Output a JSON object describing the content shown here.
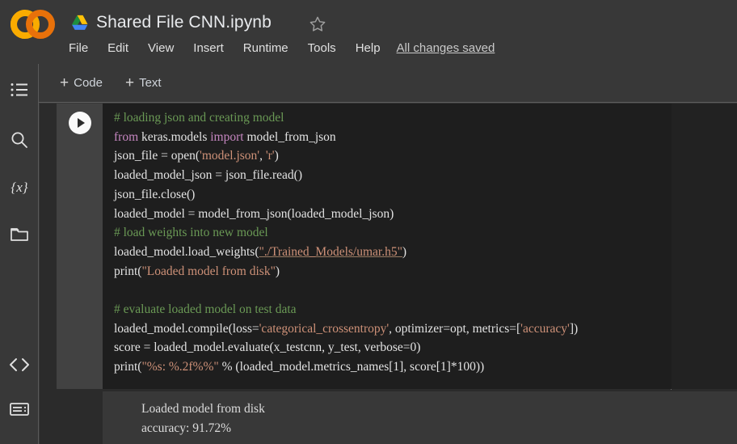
{
  "header": {
    "logo_name": "colab-logo",
    "drive_icon": "google-drive-icon",
    "doc_title": "Shared File CNN.ipynb",
    "star_icon": "star-outline-icon",
    "menu": [
      "File",
      "Edit",
      "View",
      "Insert",
      "Runtime",
      "Tools",
      "Help"
    ],
    "saved_status": "All changes saved"
  },
  "toolbar": {
    "add_code_plus": "+",
    "add_code_label": "Code",
    "add_text_plus": "+",
    "add_text_label": "Text"
  },
  "sidebar": {
    "items": [
      {
        "name": "table-of-contents-icon",
        "label": "Table of contents"
      },
      {
        "name": "search-icon",
        "label": "Find and replace"
      },
      {
        "name": "variables-icon",
        "label": "Variables"
      },
      {
        "name": "files-folder-icon",
        "label": "Files"
      }
    ],
    "bottom_items": [
      {
        "name": "code-snippets-icon",
        "label": "Code snippets"
      },
      {
        "name": "command-palette-icon",
        "label": "Command palette"
      }
    ]
  },
  "cell": {
    "run_button": "run-cell-button",
    "code_lines": [
      [
        {
          "t": "comment",
          "s": "# loading json and creating model"
        }
      ],
      [
        {
          "t": "kw",
          "s": "from"
        },
        {
          "t": "plain",
          "s": " keras.models "
        },
        {
          "t": "kw",
          "s": "import"
        },
        {
          "t": "plain",
          "s": " model_from_json"
        }
      ],
      [
        {
          "t": "plain",
          "s": "json_file = open("
        },
        {
          "t": "str",
          "s": "'model.json'"
        },
        {
          "t": "plain",
          "s": ", "
        },
        {
          "t": "str",
          "s": "'r'"
        },
        {
          "t": "plain",
          "s": ")"
        }
      ],
      [
        {
          "t": "plain",
          "s": "loaded_model_json = json_file.read()"
        }
      ],
      [
        {
          "t": "plain",
          "s": "json_file.close()"
        }
      ],
      [
        {
          "t": "plain",
          "s": "loaded_model = model_from_json(loaded_model_json)"
        }
      ],
      [
        {
          "t": "comment",
          "s": "# load weights into new model"
        }
      ],
      [
        {
          "t": "plain",
          "s": "loaded_model.load_weights("
        },
        {
          "t": "str-underline",
          "s": "\"./Trained_Models/umar.h5\""
        },
        {
          "t": "plain",
          "s": ")"
        }
      ],
      [
        {
          "t": "plain",
          "s": "print("
        },
        {
          "t": "str",
          "s": "\"Loaded model from disk\""
        },
        {
          "t": "plain",
          "s": ")"
        }
      ],
      [
        {
          "t": "plain",
          "s": ""
        }
      ],
      [
        {
          "t": "comment",
          "s": "# evaluate loaded model on test data"
        }
      ],
      [
        {
          "t": "plain",
          "s": "loaded_model.compile(loss="
        },
        {
          "t": "str",
          "s": "'categorical_crossentropy'"
        },
        {
          "t": "plain",
          "s": ", optimizer=opt, metrics=["
        },
        {
          "t": "str",
          "s": "'accuracy'"
        },
        {
          "t": "plain",
          "s": "])"
        }
      ],
      [
        {
          "t": "plain",
          "s": "score = loaded_model.evaluate(x_testcnn, y_test, verbose=0)"
        }
      ],
      [
        {
          "t": "plain",
          "s": "print("
        },
        {
          "t": "str",
          "s": "\"%s: %.2f%%\""
        },
        {
          "t": "plain",
          "s": " % (loaded_model.metrics_names[1], score[1]*100))"
        }
      ]
    ]
  },
  "output": {
    "lines": [
      "Loaded model from disk",
      "accuracy: 91.72%"
    ]
  },
  "colors": {
    "comment": "#6a9955",
    "keyword": "#c586c0",
    "string": "#ce9178",
    "plain": "#e3e3e3",
    "code_bg": "#1e1e1e",
    "chrome_bg": "#383838",
    "output_bg": "#383838"
  }
}
